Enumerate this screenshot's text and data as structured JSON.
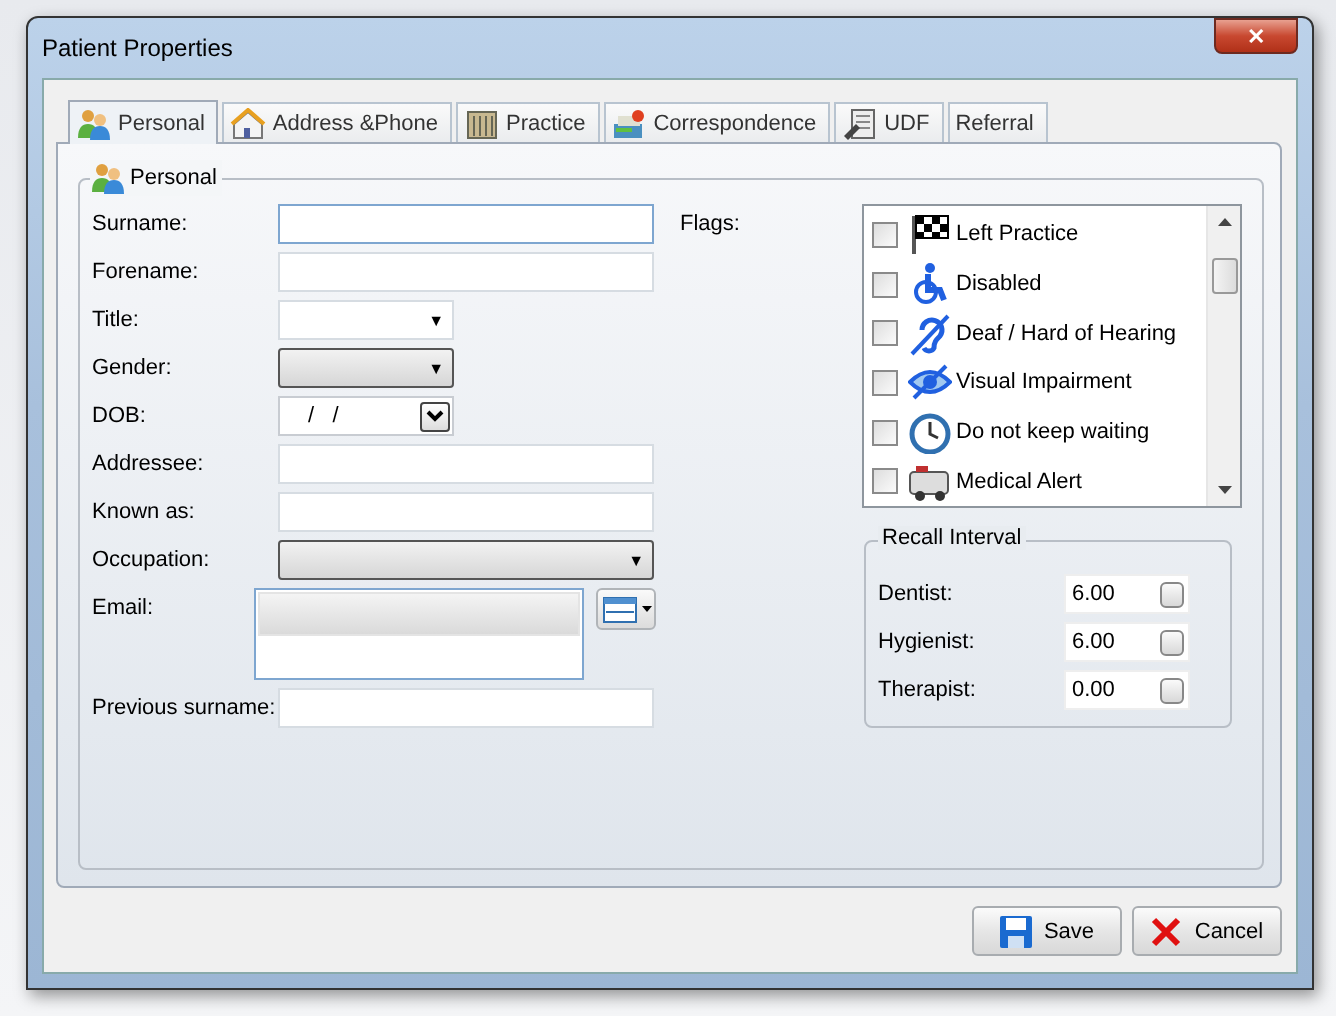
{
  "window": {
    "title": "Patient Properties",
    "close": "✕"
  },
  "tabs": [
    {
      "label": "Personal",
      "selected": true
    },
    {
      "label": "Address &Phone",
      "selected": false
    },
    {
      "label": "Practice",
      "selected": false
    },
    {
      "label": "Correspondence",
      "selected": false
    },
    {
      "label": "UDF",
      "selected": false
    },
    {
      "label": "Referral",
      "selected": false
    }
  ],
  "group": {
    "title": "Personal"
  },
  "fields": [
    {
      "label": "Surname:",
      "kind": "text",
      "focused": true
    },
    {
      "label": "Forename:",
      "kind": "text",
      "focused": false
    },
    {
      "label": "Title:",
      "kind": "combo",
      "arrow": "▼"
    },
    {
      "label": "Gender:",
      "kind": "dropdown",
      "arrow": "▼"
    },
    {
      "label": "DOB:",
      "kind": "date",
      "value": "/   /"
    },
    {
      "label": "Addressee:",
      "kind": "text",
      "focused": false
    },
    {
      "label": "Known as:",
      "kind": "text",
      "focused": false
    },
    {
      "label": "Occupation:",
      "kind": "widedropdown",
      "arrow": "▼"
    },
    {
      "label": "Email:",
      "kind": "memo"
    },
    {
      "label": "Previous surname:",
      "kind": "text",
      "focused": false
    }
  ],
  "flags": {
    "label": "Flags:",
    "items": [
      {
        "label": "Left Practice",
        "checked": false
      },
      {
        "label": "Disabled",
        "checked": false
      },
      {
        "label": "Deaf / Hard of Hearing",
        "checked": false
      },
      {
        "label": "Visual Impairment",
        "checked": false
      },
      {
        "label": "Do not keep waiting",
        "checked": false
      },
      {
        "label": "Medical Alert",
        "checked": false
      }
    ]
  },
  "recall": {
    "title": "Recall Interval",
    "rows": [
      {
        "label": "Dentist:",
        "value": "6.00"
      },
      {
        "label": "Hygienist:",
        "value": "6.00"
      },
      {
        "label": "Therapist:",
        "value": "0.00"
      }
    ]
  },
  "buttons": [
    {
      "label": "Save",
      "kind": "save"
    },
    {
      "label": "Cancel",
      "kind": "cancel"
    }
  ]
}
